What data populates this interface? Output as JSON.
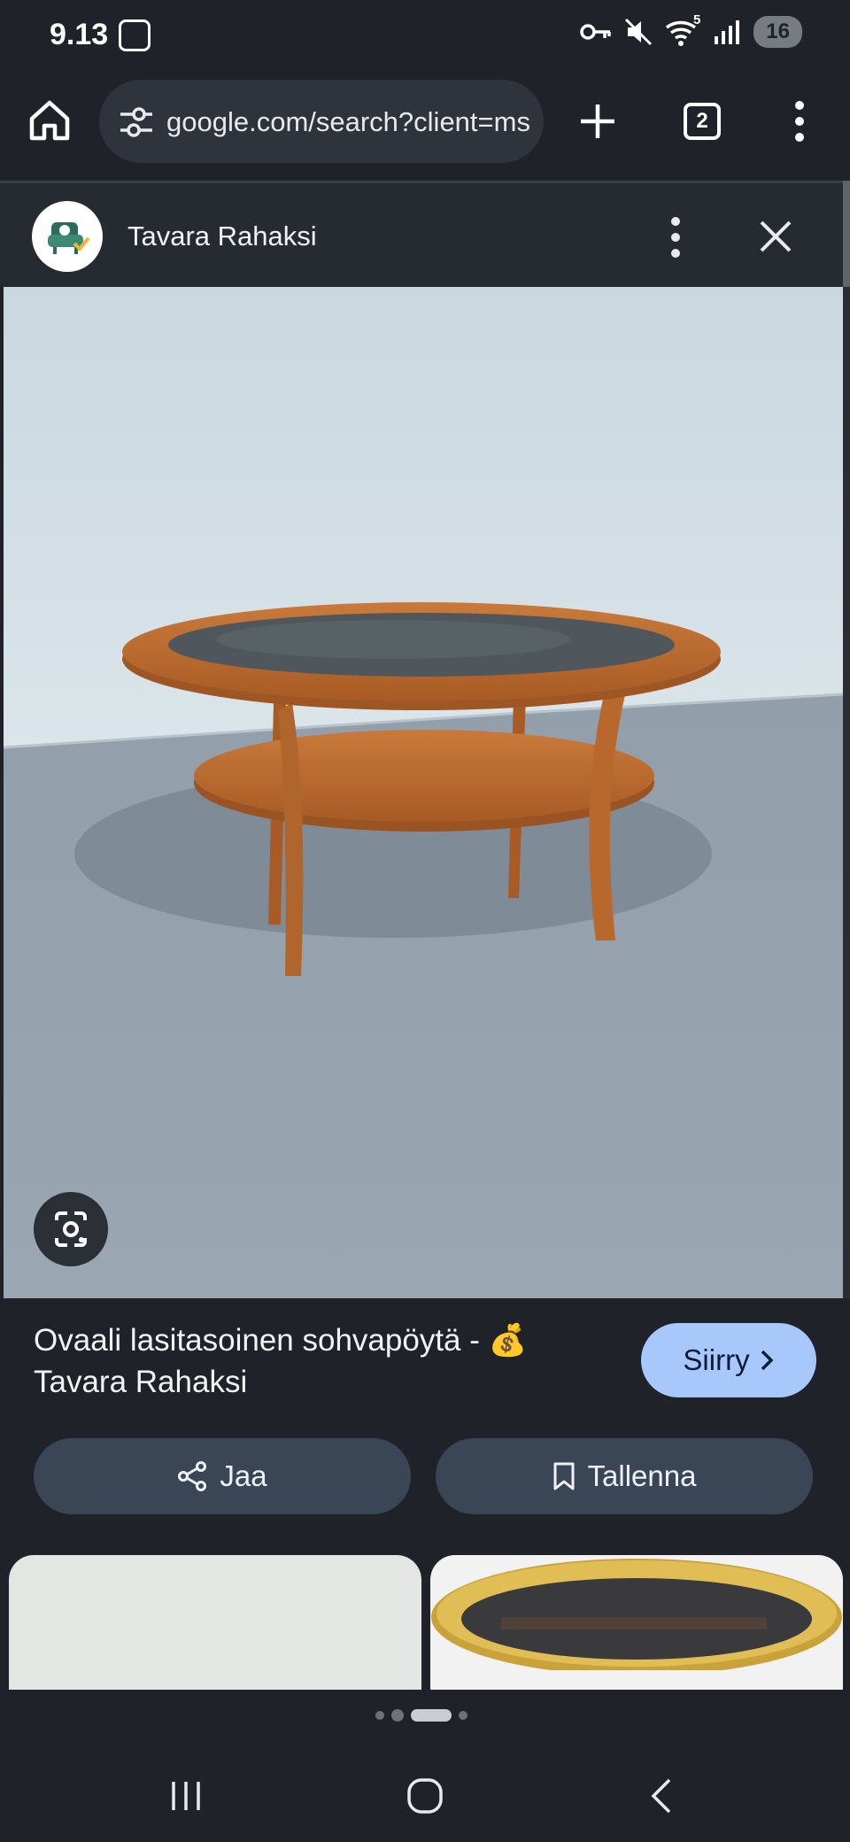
{
  "status_bar": {
    "time": "9.13",
    "battery": "16",
    "wifi_level": "5"
  },
  "browser": {
    "url": "google.com/search?client=ms",
    "tab_count": "2"
  },
  "sheet": {
    "site_name": "Tavara Rahaksi"
  },
  "result": {
    "title_line1": "Ovaali lasitasoinen sohvapöytä - 💰",
    "title_line2": "Tavara Rahaksi",
    "go_label": "Siirry",
    "share_label": "Jaa",
    "save_label": "Tallenna"
  },
  "pager": {
    "count": 4,
    "active_index": 2
  },
  "colors": {
    "background": "#1f2228",
    "accent_button": "#a8c7fa",
    "action_button": "#3a4556"
  }
}
